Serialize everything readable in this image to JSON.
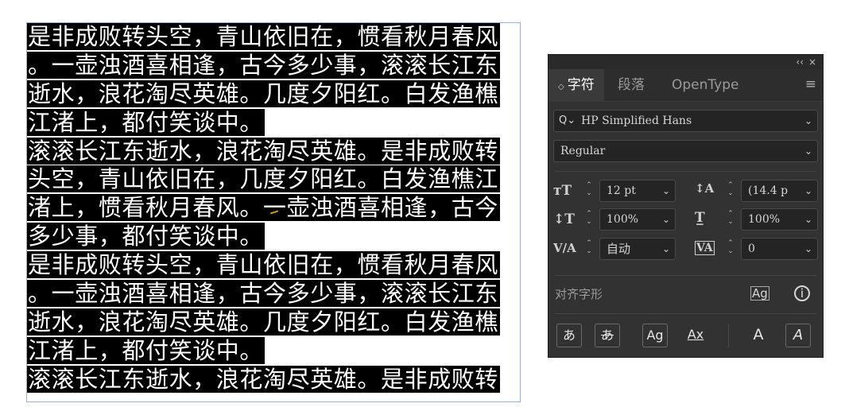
{
  "text_frame": {
    "lines": [
      "是非成败转头空，青山依旧在，惯看秋月春风",
      "。一壶浊酒喜相逢，古今多少事，滚滚长江东",
      "逝水，浪花淘尽英雄。几度夕阳红。白发渔樵",
      "江渚上，都付笑谈中。",
      "滚滚长江东逝水，浪花淘尽英雄。是非成败转",
      "头空，青山依旧在，几度夕阳红。白发渔樵江",
      "渚上，惯看秋月春风。一壶浊酒喜相逢，古今",
      "多少事，都付笑谈中。",
      "是非成败转头空，青山依旧在，惯看秋月春风",
      "。一壶浊酒喜相逢，古今多少事，滚滚长江东",
      "逝水，浪花淘尽英雄。几度夕阳红。白发渔樵",
      "江渚上，都付笑谈中。",
      "滚滚长江东逝水，浪花淘尽英雄。是非成败转"
    ]
  },
  "panel": {
    "titlebar": {
      "collapse": "‹‹",
      "close": "×"
    },
    "tabs": [
      {
        "label": "字符",
        "active": true
      },
      {
        "label": "段落",
        "active": false
      },
      {
        "label": "OpenType",
        "active": false
      }
    ],
    "menu_icon": "≡",
    "font_family": "HP Simplified Hans",
    "font_style": "Regular",
    "font_size": "12 pt",
    "leading": "(14.4 p",
    "vertical_scale": "100%",
    "horizontal_scale": "100%",
    "kerning": "自动",
    "tracking": "0",
    "align_glyphs_label": "对齐字形",
    "bottom_buttons": [
      "あ",
      "あ",
      "Ag",
      "Ax",
      "A",
      "A"
    ],
    "colors": {
      "panel_bg": "#323232",
      "field_bg": "#242424",
      "text": "#d6d6d6"
    }
  }
}
